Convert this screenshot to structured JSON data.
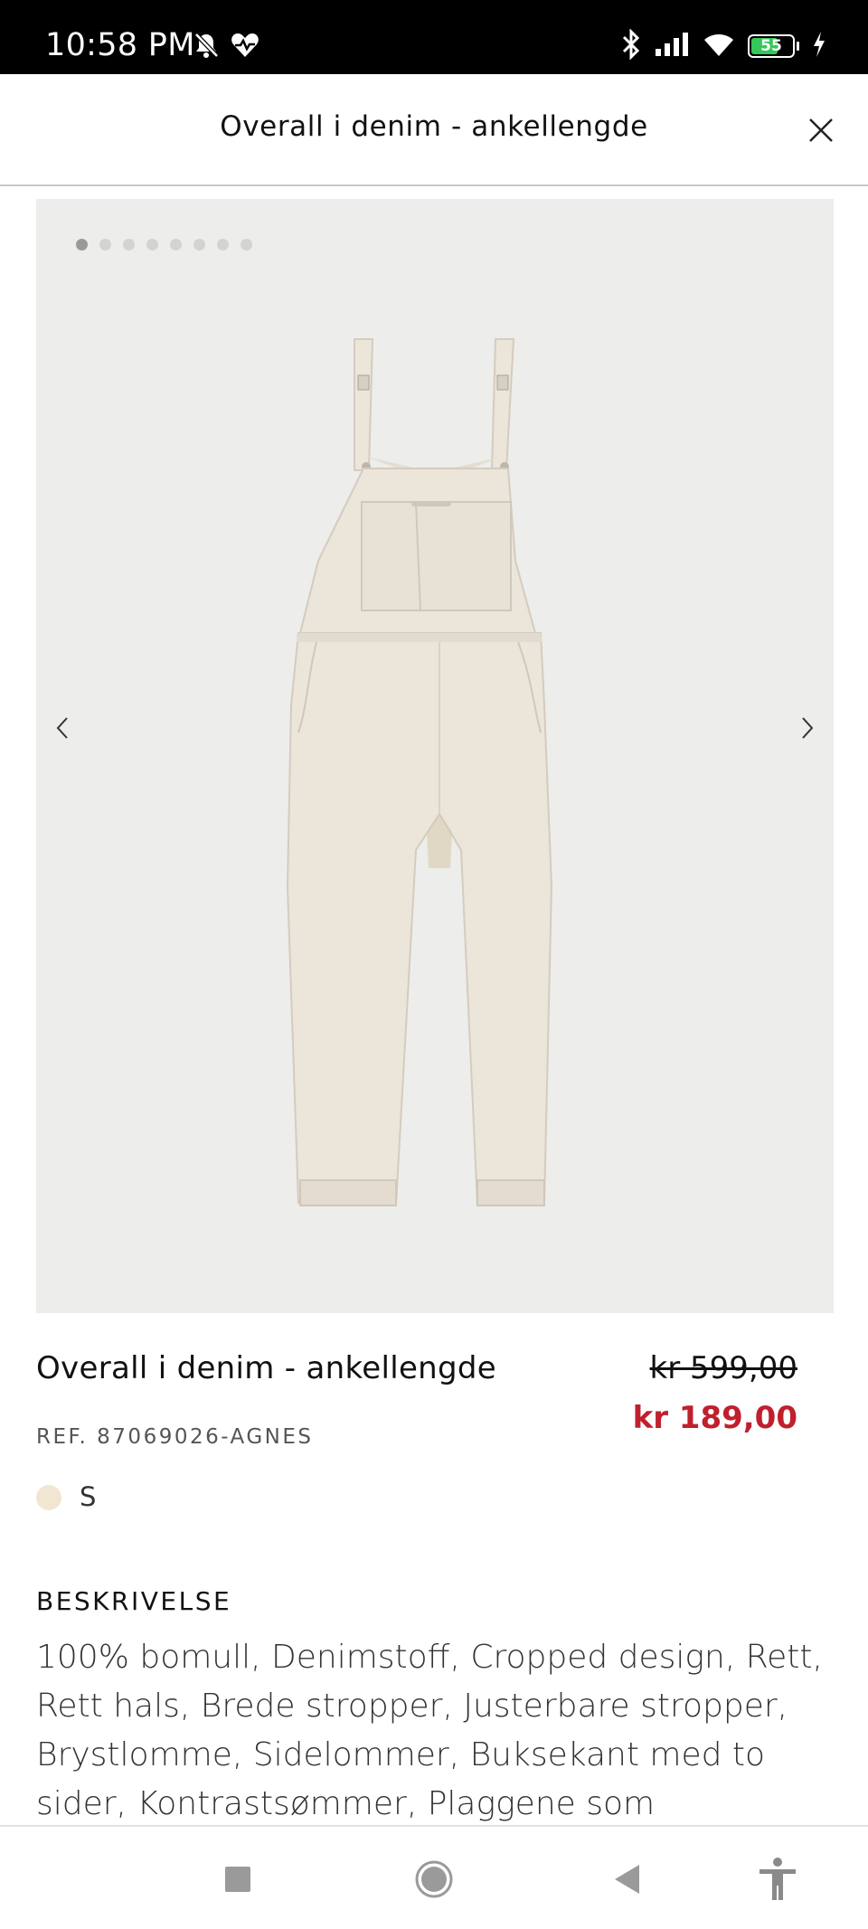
{
  "status_bar": {
    "time": "10:58 PM",
    "battery_level": "55",
    "icons": [
      "mute-icon",
      "heart-rate-icon",
      "bluetooth-icon",
      "signal-icon",
      "wifi-icon",
      "battery-icon",
      "charging-icon"
    ]
  },
  "header": {
    "title": "Overall i denim - ankellengde",
    "close_icon": "close-icon"
  },
  "carousel": {
    "total_images": 8,
    "active_index": 0,
    "prev_icon": "chevron-left-icon",
    "next_icon": "chevron-right-icon"
  },
  "product": {
    "name": "Overall i denim - ankellengde",
    "price_old": "kr 599,00",
    "price_new": "kr 189,00",
    "ref": "REF. 87069026-AGNES",
    "color_hex": "#f1e6d1",
    "size": "S"
  },
  "description": {
    "heading": "BESKRIVELSE",
    "text": "100% bomull, Denimstoff, Cropped design, Rett, Rett hals, Brede stropper, Justerbare stropper, Brystlomme, Sidelommer, Buksekant med to sider, Kontrastsømmer, Plaggene som"
  },
  "nav_bar": {
    "icons": [
      "recents-icon",
      "home-icon",
      "back-icon",
      "accessibility-icon"
    ]
  },
  "colors": {
    "sale_red": "#c0202d",
    "image_background": "#ededeb"
  }
}
